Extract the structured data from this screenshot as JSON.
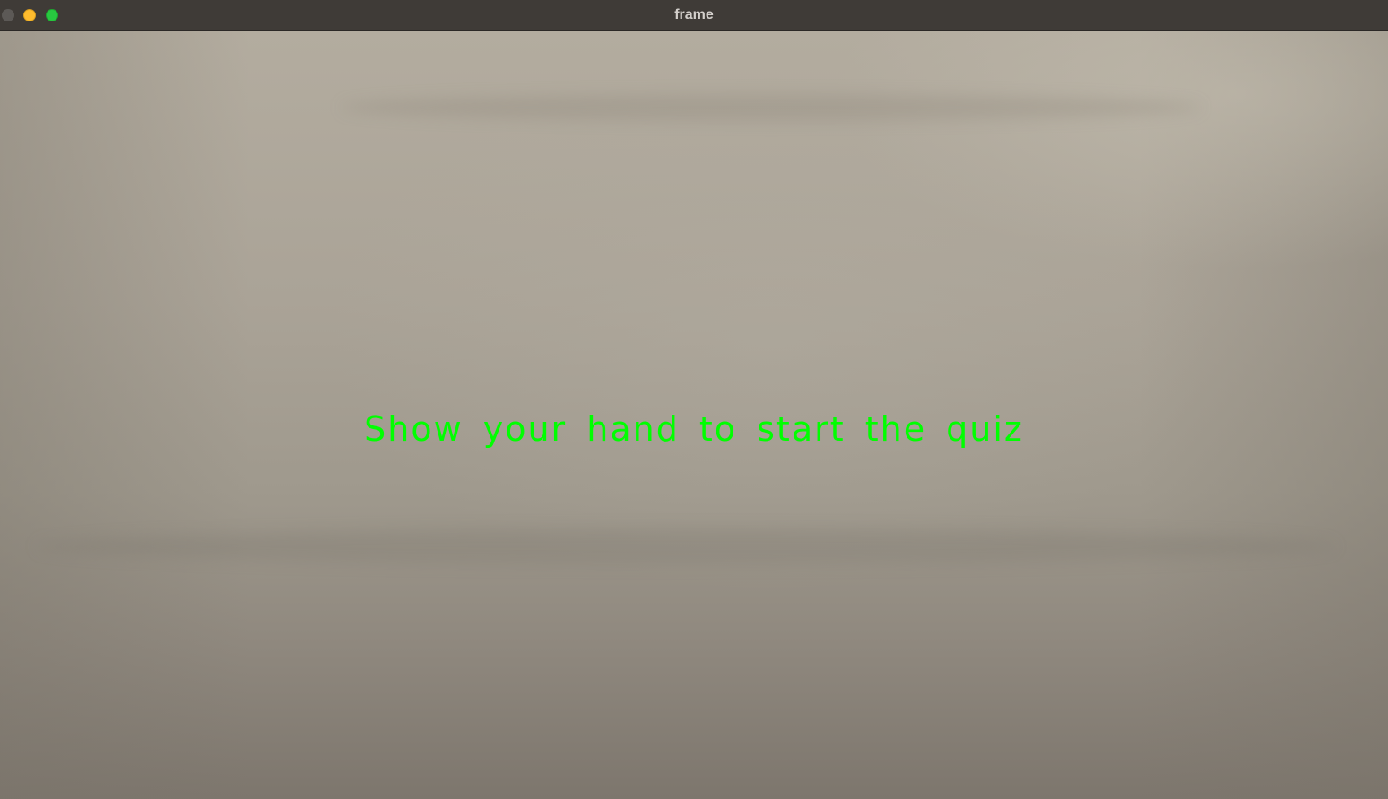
{
  "window": {
    "title": "frame"
  },
  "overlay": {
    "message": "Show your hand to start the quiz",
    "color": "#00ff00"
  },
  "icons": {
    "close": "close-traffic-light-icon",
    "minimize": "minimize-traffic-light-icon",
    "zoom": "zoom-traffic-light-icon"
  }
}
